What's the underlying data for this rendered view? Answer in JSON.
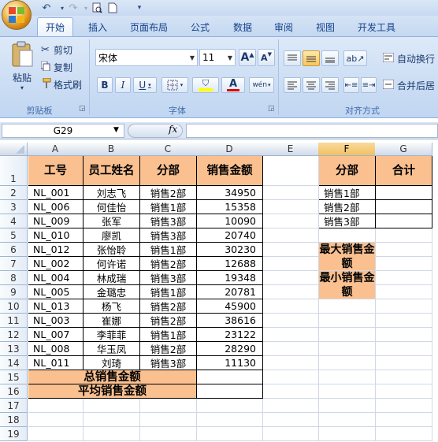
{
  "app": {
    "tabs": [
      "开始",
      "插入",
      "页面布局",
      "公式",
      "数据",
      "审阅",
      "视图",
      "开发工具"
    ],
    "active_tab": "开始"
  },
  "ribbon": {
    "clipboard": {
      "paste": "粘贴",
      "cut": "剪切",
      "copy": "复制",
      "format_painter": "格式刷",
      "group_label": "剪贴板"
    },
    "font": {
      "font_name": "宋体",
      "font_size": "11",
      "bold": "B",
      "italic": "I",
      "underline": "U",
      "grow": "A",
      "shrink": "A",
      "font_color_letter": "A",
      "phonetic": "wén",
      "group_label": "字体"
    },
    "alignment": {
      "wrap_text": "自动换行",
      "merge_center": "合并后居",
      "group_label": "对齐方式"
    }
  },
  "formula_bar": {
    "name_box": "G29",
    "fx": "fx",
    "formula": ""
  },
  "colors": {
    "header_fill": "#fac090",
    "selected_col": "#f1c15f",
    "red": "#e00000",
    "yellow": "#ffff00"
  },
  "grid": {
    "columns": [
      "A",
      "B",
      "C",
      "D",
      "E",
      "F",
      "G"
    ],
    "selected_column": "F",
    "rows": [
      "1",
      "2",
      "3",
      "4",
      "5",
      "6",
      "7",
      "8",
      "9",
      "10",
      "11",
      "12",
      "13",
      "14",
      "15",
      "16",
      "17",
      "18",
      "19"
    ],
    "headers": {
      "A": "工号",
      "B": "员工姓名",
      "C": "分部",
      "D": "销售金额",
      "F": "分部",
      "G": "合计"
    },
    "records": [
      {
        "id": "NL_001",
        "name": "刘志飞",
        "dept": "销售2部",
        "amount": "34950"
      },
      {
        "id": "NL_006",
        "name": "何佳怡",
        "dept": "销售1部",
        "amount": "15358"
      },
      {
        "id": "NL_009",
        "name": "张军",
        "dept": "销售3部",
        "amount": "10090"
      },
      {
        "id": "NL_010",
        "name": "廖凯",
        "dept": "销售3部",
        "amount": "20740"
      },
      {
        "id": "NL_012",
        "name": "张怡聆",
        "dept": "销售1部",
        "amount": "30230"
      },
      {
        "id": "NL_002",
        "name": "何许诺",
        "dept": "销售2部",
        "amount": "12688"
      },
      {
        "id": "NL_004",
        "name": "林成瑞",
        "dept": "销售3部",
        "amount": "19348"
      },
      {
        "id": "NL_005",
        "name": "金璐忠",
        "dept": "销售1部",
        "amount": "20781"
      },
      {
        "id": "NL_013",
        "name": "杨飞",
        "dept": "销售2部",
        "amount": "45900"
      },
      {
        "id": "NL_003",
        "name": "崔娜",
        "dept": "销售2部",
        "amount": "38616"
      },
      {
        "id": "NL_007",
        "name": "李菲菲",
        "dept": "销售1部",
        "amount": "23122"
      },
      {
        "id": "NL_008",
        "name": "华玉凤",
        "dept": "销售2部",
        "amount": "28290"
      },
      {
        "id": "NL_011",
        "name": "刘琦",
        "dept": "销售3部",
        "amount": "11130"
      }
    ],
    "total_label": "总销售金额",
    "avg_label": "平均销售金额",
    "summary_depts": [
      "销售1部",
      "销售2部",
      "销售3部"
    ],
    "max_label": "最大销售金额",
    "min_label": "最小销售金额"
  }
}
